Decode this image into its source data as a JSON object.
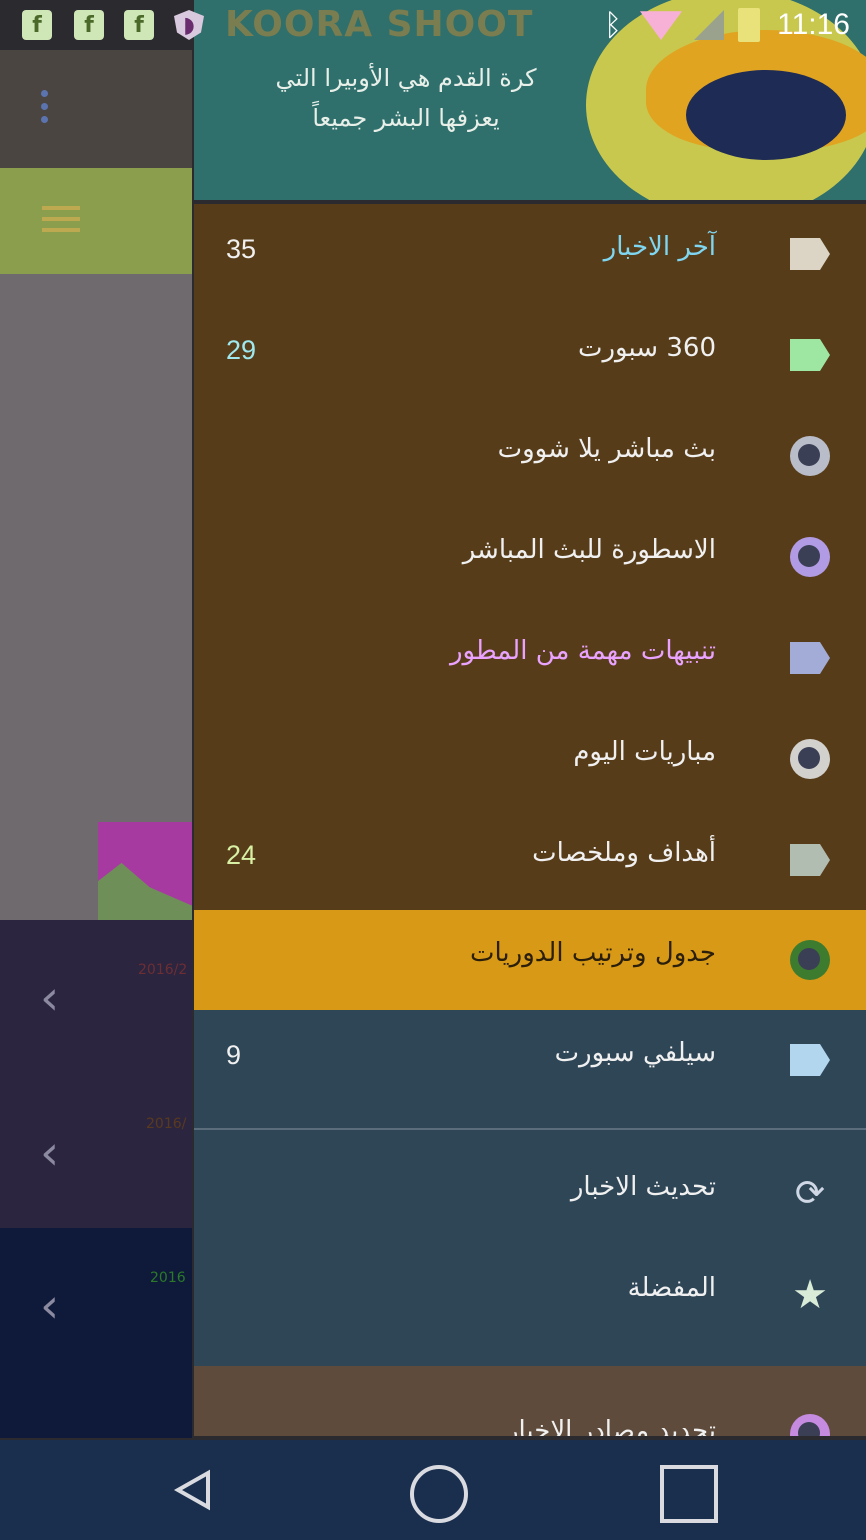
{
  "status_bar": {
    "brand_text": "KOORA SHOOT",
    "time": "11:16"
  },
  "banner": {
    "quote_line1": "كرة القدم هي الأوبيرا التي",
    "quote_line2": "يعزفها البشر جميعاً"
  },
  "drawer": {
    "items": [
      {
        "label": "آخر الاخبار",
        "count": "35",
        "icon": "tag-icon",
        "icon_color": "#dcd5c5",
        "label_color": "#7fd6f0"
      },
      {
        "label": "360 سبورت",
        "count": "29",
        "icon": "tag-icon",
        "icon_color": "#9ee7a3",
        "label_color": "#e9e4d8"
      },
      {
        "label": "بث مباشر يلا شووت",
        "count": "",
        "icon": "globe-icon",
        "icon_color": "#b9bdc9",
        "label_color": "#e9e4d8"
      },
      {
        "label": "الاسطورة للبث المباشر",
        "count": "",
        "icon": "globe-icon",
        "icon_color": "#b29be5",
        "label_color": "#e9e4d8"
      },
      {
        "label": "تنبيهات مهمة من المطور",
        "count": "",
        "icon": "tag-icon",
        "icon_color": "#a3acd6",
        "label_color": "#e9a3ff"
      },
      {
        "label": "مباريات اليوم",
        "count": "",
        "icon": "globe-icon",
        "icon_color": "#d3d1cd",
        "label_color": "#e9e4d8"
      },
      {
        "label": "أهداف وملخصات",
        "count": "24",
        "icon": "tag-icon",
        "icon_color": "#b2bdb1",
        "label_color": "#e9e4d8"
      },
      {
        "label": "جدول وترتيب الدوريات",
        "count": "",
        "icon": "globe-icon",
        "icon_color": "#3d7b2f",
        "label_color": "#2b1f0c"
      },
      {
        "label": "سيلفي سبورت",
        "count": "9",
        "icon": "tag-icon",
        "icon_color": "#b2d6ee",
        "label_color": "#e9e4d8"
      },
      {
        "label": "تحديث الاخبار",
        "count": "",
        "icon": "refresh-icon",
        "icon_color": "#cfd8e4",
        "label_color": "#e9e4d8"
      },
      {
        "label": "المفضلة",
        "count": "",
        "icon": "star-icon",
        "icon_color": "#d9ecd8",
        "label_color": "#e9e4d8"
      },
      {
        "label": "تحديد مصادر الاخبار",
        "count": "",
        "icon": "compass-icon",
        "icon_color": "#c48be0",
        "label_color": "#e9e4d8"
      }
    ]
  },
  "left_panel": {
    "date_fragment_1": "2016/2",
    "date_fragment_2": "2016/",
    "date_fragment_3": "2016"
  }
}
